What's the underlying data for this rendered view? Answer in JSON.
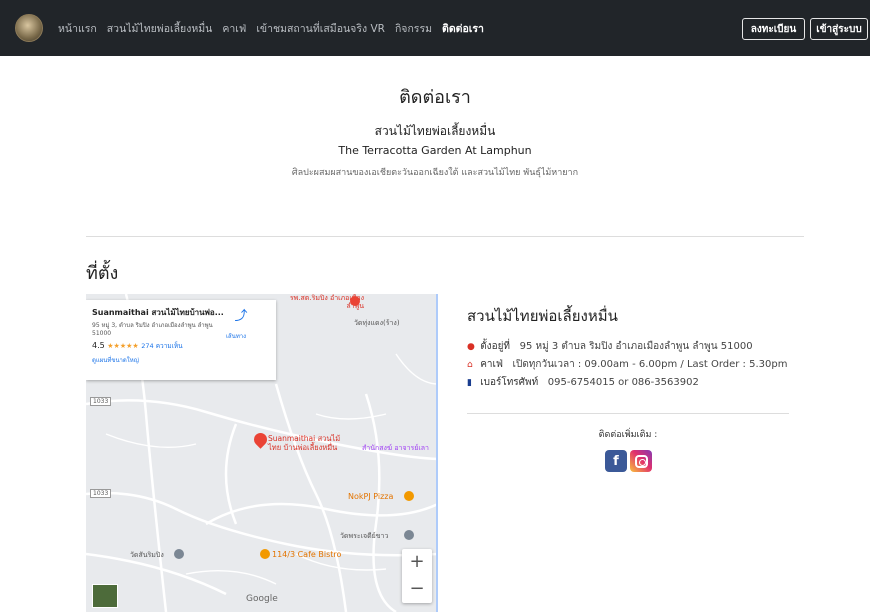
{
  "nav": {
    "links": [
      "หน้าแรก",
      "สวนไม้ไทยพ่อเลี้ยงหมื่น",
      "คาเฟ่",
      "เข้าชมสถานที่เสมือนจริง VR",
      "กิจกรรม",
      "ติดต่อเรา"
    ],
    "active_index": 5,
    "register_label": "ลงทะเบียน",
    "login_label": "เข้าสู่ระบบ"
  },
  "hero": {
    "title": "ติดต่อเรา",
    "name_th": "สวนไม้ไทยพ่อเลี้ยงหมื่น",
    "name_en": "The Terracotta Garden At Lamphun",
    "description": "ศิลปะผสมผสานของเอเชียตะวันออกเฉียงใต้ และสวนไม้ไทย พันธุ์ไม้หายาก"
  },
  "location": {
    "heading": "ที่ตั้ง",
    "map": {
      "card_title": "Suanmaithai สวนไม้ไทยบ้านพ่อ...",
      "card_address": "95 หมู่ 3, ตำบล ริมปิง อำเภอเมืองลำพูน ลำพูน 51000",
      "rating": "4.5",
      "stars": "★★★★★",
      "reviews": "274 ความเห็น",
      "larger_map": "ดูแผนที่ขนาดใหญ่",
      "directions": "เส้นทาง",
      "labels": {
        "hospital": "รพ.สต.ริมปิง อำเภอเมืองลำพูน",
        "temple_top": "วัดทุ่งแดง(ร้าง)",
        "place_main": "Suanmaithai สวนไม้ไทย บ้านพ่อเลี้ยงหมื่น",
        "office": "สำนักสงฆ์ อาจารย์เลา",
        "pizza": "NokPJ Pizza",
        "temple_right": "วัดพระเจดีย์ขาว",
        "temple_left": "วัดสันริมปิง",
        "cafe": "114/3 Cafe Bistro",
        "route1": "1033",
        "route2": "1033",
        "google": "Google"
      },
      "zoom_in": "+",
      "zoom_out": "−"
    },
    "info": {
      "title": "สวนไม้ไทยพ่อเลี้ยงหมื่น",
      "address_label": "ตั้งอยู่ที่",
      "address": "95 หมู่ 3 ตำบล ริมปิง อำเภอเมืองลำพูน ลำพูน 51000",
      "cafe_label": "คาเฟ่",
      "hours": "เปิดทุกวันเวลา : 09.00am - 6.00pm / Last Order : 5.30pm",
      "phone_label": "เบอร์โทรศัพท์",
      "phone": "095-6754015 or 086-3563902",
      "more_contact": "ติดต่อเพิ่มเติม :",
      "facebook_glyph": "f"
    }
  },
  "colors": {
    "navbar": "#212529",
    "facebook": "#3b5998",
    "pin": "#ea4335"
  }
}
